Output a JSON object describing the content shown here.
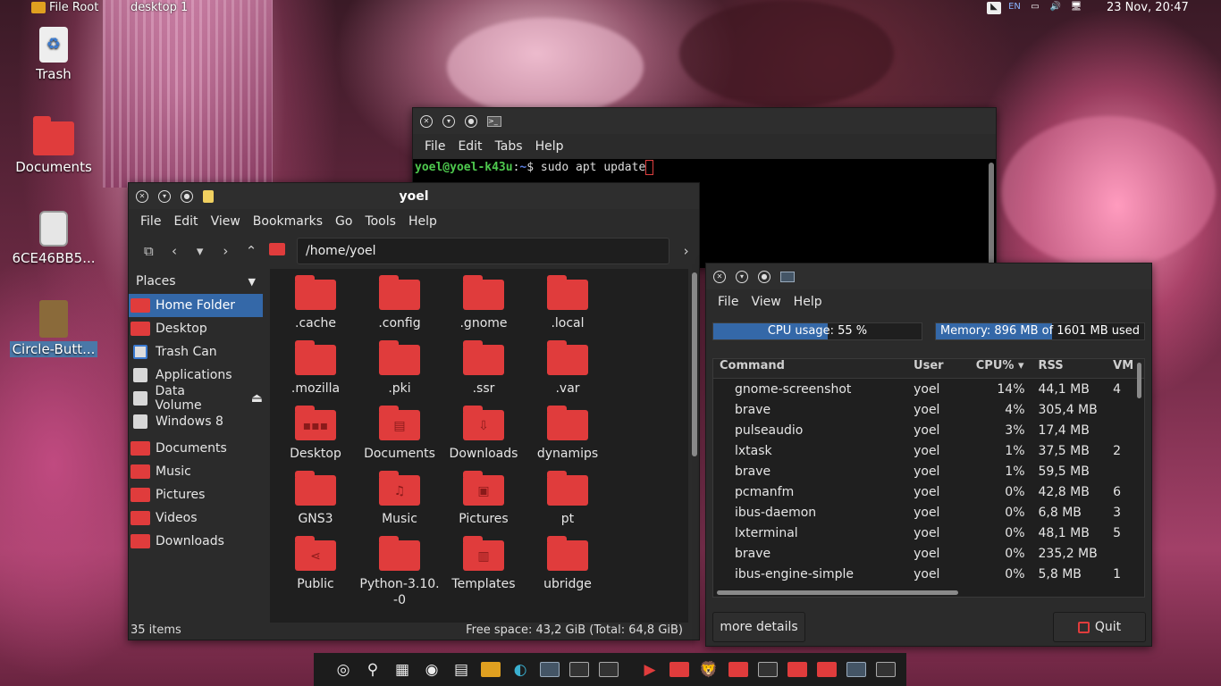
{
  "panel": {
    "file_root": "File Root",
    "desktop": "desktop 1",
    "lang": "EN",
    "clock": "23 Nov, 20:47"
  },
  "desktop_icons": [
    {
      "label": "Trash"
    },
    {
      "label": "Documents"
    },
    {
      "label": "6CE46BB5..."
    },
    {
      "label": "Circle-Butt..."
    }
  ],
  "terminal": {
    "menu": [
      "File",
      "Edit",
      "Tabs",
      "Help"
    ],
    "prompt_user": "yoel@yoel-k43u",
    "prompt_sep": ":",
    "prompt_path": "~",
    "prompt_dollar": "$ ",
    "command": "sudo apt update"
  },
  "file_manager": {
    "title": "yoel",
    "menu": [
      "File",
      "Edit",
      "View",
      "Bookmarks",
      "Go",
      "Tools",
      "Help"
    ],
    "path": "/home/yoel",
    "places_label": "Places",
    "places": [
      {
        "label": "Home Folder"
      },
      {
        "label": "Desktop"
      },
      {
        "label": "Trash Can"
      },
      {
        "label": "Applications"
      },
      {
        "label": "Data Volume"
      },
      {
        "label": "Windows 8"
      }
    ],
    "bookmarks": [
      {
        "label": "Documents"
      },
      {
        "label": "Music"
      },
      {
        "label": "Pictures"
      },
      {
        "label": "Videos"
      },
      {
        "label": "Downloads"
      }
    ],
    "items": [
      ".cache",
      ".config",
      ".gnome",
      ".local",
      ".mozilla",
      ".pki",
      ".ssr",
      ".var",
      "Desktop",
      "Documents",
      "Downloads",
      "dynamips",
      "GNS3",
      "Music",
      "Pictures",
      "pt",
      "Public",
      "Python-3.10.-0",
      "Templates",
      "ubridge"
    ],
    "status_items": "35 items",
    "status_free": "Free space: 43,2 GiB (Total: 64,8 GiB)"
  },
  "task_manager": {
    "menu": [
      "File",
      "View",
      "Help"
    ],
    "cpu_label": "CPU usage: 55 %",
    "cpu_percent": 55,
    "mem_label": "Memory: 896 MB of 1601 MB used",
    "mem_fraction": 0.56,
    "columns": [
      "Command",
      "User",
      "CPU% ▾",
      "RSS",
      "VM"
    ],
    "rows": [
      [
        "gnome-screenshot",
        "yoel",
        "14%",
        "44,1 MB",
        "4"
      ],
      [
        "brave",
        "yoel",
        "4%",
        "305,4 MB",
        ""
      ],
      [
        "pulseaudio",
        "yoel",
        "3%",
        "17,4 MB",
        ""
      ],
      [
        "lxtask",
        "yoel",
        "1%",
        "37,5 MB",
        "2"
      ],
      [
        "brave",
        "yoel",
        "1%",
        "59,5 MB",
        ""
      ],
      [
        "pcmanfm",
        "yoel",
        "0%",
        "42,8 MB",
        "6"
      ],
      [
        "ibus-daemon",
        "yoel",
        "0%",
        "6,8 MB",
        "3"
      ],
      [
        "lxterminal",
        "yoel",
        "0%",
        "48,1 MB",
        "5"
      ],
      [
        "brave",
        "yoel",
        "0%",
        "235,2 MB",
        ""
      ],
      [
        "ibus-engine-simple",
        "yoel",
        "0%",
        "5,8 MB",
        "1"
      ]
    ],
    "more_details": "more details",
    "quit": "Quit"
  }
}
